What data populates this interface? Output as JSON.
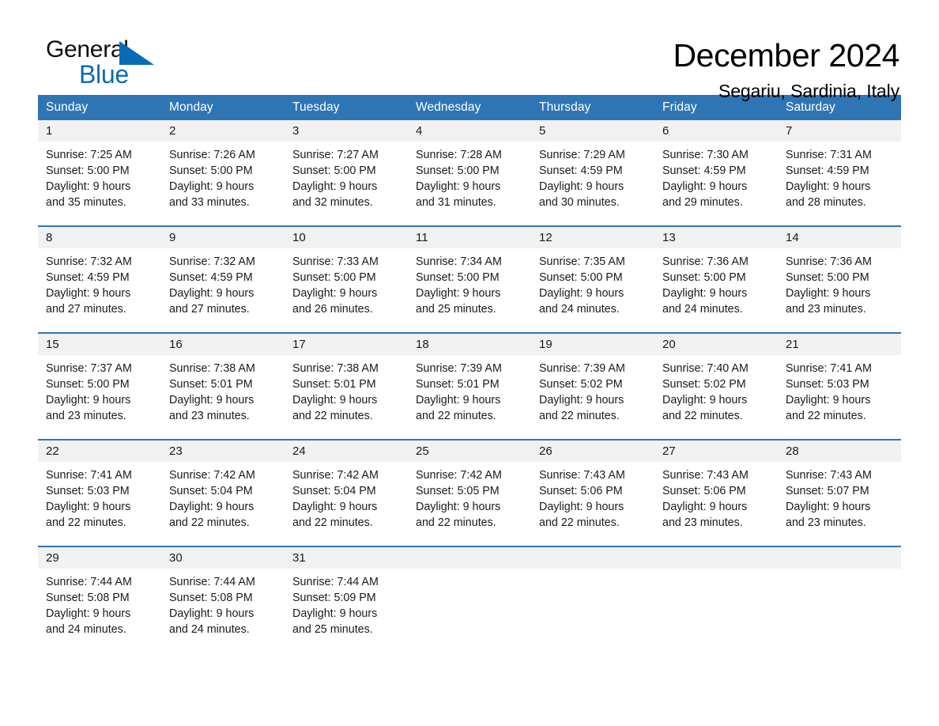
{
  "brand": {
    "name_part1": "General",
    "name_part2": "Blue",
    "triangle_color": "#0a6bb5",
    "accent_color": "#2e75b6"
  },
  "header": {
    "month_title": "December 2024",
    "location": "Segariu, Sardinia, Italy"
  },
  "calendar": {
    "weekday_headers": [
      "Sunday",
      "Monday",
      "Tuesday",
      "Wednesday",
      "Thursday",
      "Friday",
      "Saturday"
    ],
    "weeks": [
      [
        {
          "day": "1",
          "sunrise": "Sunrise: 7:25 AM",
          "sunset": "Sunset: 5:00 PM",
          "daylight_line1": "Daylight: 9 hours",
          "daylight_line2": "and 35 minutes."
        },
        {
          "day": "2",
          "sunrise": "Sunrise: 7:26 AM",
          "sunset": "Sunset: 5:00 PM",
          "daylight_line1": "Daylight: 9 hours",
          "daylight_line2": "and 33 minutes."
        },
        {
          "day": "3",
          "sunrise": "Sunrise: 7:27 AM",
          "sunset": "Sunset: 5:00 PM",
          "daylight_line1": "Daylight: 9 hours",
          "daylight_line2": "and 32 minutes."
        },
        {
          "day": "4",
          "sunrise": "Sunrise: 7:28 AM",
          "sunset": "Sunset: 5:00 PM",
          "daylight_line1": "Daylight: 9 hours",
          "daylight_line2": "and 31 minutes."
        },
        {
          "day": "5",
          "sunrise": "Sunrise: 7:29 AM",
          "sunset": "Sunset: 4:59 PM",
          "daylight_line1": "Daylight: 9 hours",
          "daylight_line2": "and 30 minutes."
        },
        {
          "day": "6",
          "sunrise": "Sunrise: 7:30 AM",
          "sunset": "Sunset: 4:59 PM",
          "daylight_line1": "Daylight: 9 hours",
          "daylight_line2": "and 29 minutes."
        },
        {
          "day": "7",
          "sunrise": "Sunrise: 7:31 AM",
          "sunset": "Sunset: 4:59 PM",
          "daylight_line1": "Daylight: 9 hours",
          "daylight_line2": "and 28 minutes."
        }
      ],
      [
        {
          "day": "8",
          "sunrise": "Sunrise: 7:32 AM",
          "sunset": "Sunset: 4:59 PM",
          "daylight_line1": "Daylight: 9 hours",
          "daylight_line2": "and 27 minutes."
        },
        {
          "day": "9",
          "sunrise": "Sunrise: 7:32 AM",
          "sunset": "Sunset: 4:59 PM",
          "daylight_line1": "Daylight: 9 hours",
          "daylight_line2": "and 27 minutes."
        },
        {
          "day": "10",
          "sunrise": "Sunrise: 7:33 AM",
          "sunset": "Sunset: 5:00 PM",
          "daylight_line1": "Daylight: 9 hours",
          "daylight_line2": "and 26 minutes."
        },
        {
          "day": "11",
          "sunrise": "Sunrise: 7:34 AM",
          "sunset": "Sunset: 5:00 PM",
          "daylight_line1": "Daylight: 9 hours",
          "daylight_line2": "and 25 minutes."
        },
        {
          "day": "12",
          "sunrise": "Sunrise: 7:35 AM",
          "sunset": "Sunset: 5:00 PM",
          "daylight_line1": "Daylight: 9 hours",
          "daylight_line2": "and 24 minutes."
        },
        {
          "day": "13",
          "sunrise": "Sunrise: 7:36 AM",
          "sunset": "Sunset: 5:00 PM",
          "daylight_line1": "Daylight: 9 hours",
          "daylight_line2": "and 24 minutes."
        },
        {
          "day": "14",
          "sunrise": "Sunrise: 7:36 AM",
          "sunset": "Sunset: 5:00 PM",
          "daylight_line1": "Daylight: 9 hours",
          "daylight_line2": "and 23 minutes."
        }
      ],
      [
        {
          "day": "15",
          "sunrise": "Sunrise: 7:37 AM",
          "sunset": "Sunset: 5:00 PM",
          "daylight_line1": "Daylight: 9 hours",
          "daylight_line2": "and 23 minutes."
        },
        {
          "day": "16",
          "sunrise": "Sunrise: 7:38 AM",
          "sunset": "Sunset: 5:01 PM",
          "daylight_line1": "Daylight: 9 hours",
          "daylight_line2": "and 23 minutes."
        },
        {
          "day": "17",
          "sunrise": "Sunrise: 7:38 AM",
          "sunset": "Sunset: 5:01 PM",
          "daylight_line1": "Daylight: 9 hours",
          "daylight_line2": "and 22 minutes."
        },
        {
          "day": "18",
          "sunrise": "Sunrise: 7:39 AM",
          "sunset": "Sunset: 5:01 PM",
          "daylight_line1": "Daylight: 9 hours",
          "daylight_line2": "and 22 minutes."
        },
        {
          "day": "19",
          "sunrise": "Sunrise: 7:39 AM",
          "sunset": "Sunset: 5:02 PM",
          "daylight_line1": "Daylight: 9 hours",
          "daylight_line2": "and 22 minutes."
        },
        {
          "day": "20",
          "sunrise": "Sunrise: 7:40 AM",
          "sunset": "Sunset: 5:02 PM",
          "daylight_line1": "Daylight: 9 hours",
          "daylight_line2": "and 22 minutes."
        },
        {
          "day": "21",
          "sunrise": "Sunrise: 7:41 AM",
          "sunset": "Sunset: 5:03 PM",
          "daylight_line1": "Daylight: 9 hours",
          "daylight_line2": "and 22 minutes."
        }
      ],
      [
        {
          "day": "22",
          "sunrise": "Sunrise: 7:41 AM",
          "sunset": "Sunset: 5:03 PM",
          "daylight_line1": "Daylight: 9 hours",
          "daylight_line2": "and 22 minutes."
        },
        {
          "day": "23",
          "sunrise": "Sunrise: 7:42 AM",
          "sunset": "Sunset: 5:04 PM",
          "daylight_line1": "Daylight: 9 hours",
          "daylight_line2": "and 22 minutes."
        },
        {
          "day": "24",
          "sunrise": "Sunrise: 7:42 AM",
          "sunset": "Sunset: 5:04 PM",
          "daylight_line1": "Daylight: 9 hours",
          "daylight_line2": "and 22 minutes."
        },
        {
          "day": "25",
          "sunrise": "Sunrise: 7:42 AM",
          "sunset": "Sunset: 5:05 PM",
          "daylight_line1": "Daylight: 9 hours",
          "daylight_line2": "and 22 minutes."
        },
        {
          "day": "26",
          "sunrise": "Sunrise: 7:43 AM",
          "sunset": "Sunset: 5:06 PM",
          "daylight_line1": "Daylight: 9 hours",
          "daylight_line2": "and 22 minutes."
        },
        {
          "day": "27",
          "sunrise": "Sunrise: 7:43 AM",
          "sunset": "Sunset: 5:06 PM",
          "daylight_line1": "Daylight: 9 hours",
          "daylight_line2": "and 23 minutes."
        },
        {
          "day": "28",
          "sunrise": "Sunrise: 7:43 AM",
          "sunset": "Sunset: 5:07 PM",
          "daylight_line1": "Daylight: 9 hours",
          "daylight_line2": "and 23 minutes."
        }
      ],
      [
        {
          "day": "29",
          "sunrise": "Sunrise: 7:44 AM",
          "sunset": "Sunset: 5:08 PM",
          "daylight_line1": "Daylight: 9 hours",
          "daylight_line2": "and 24 minutes."
        },
        {
          "day": "30",
          "sunrise": "Sunrise: 7:44 AM",
          "sunset": "Sunset: 5:08 PM",
          "daylight_line1": "Daylight: 9 hours",
          "daylight_line2": "and 24 minutes."
        },
        {
          "day": "31",
          "sunrise": "Sunrise: 7:44 AM",
          "sunset": "Sunset: 5:09 PM",
          "daylight_line1": "Daylight: 9 hours",
          "daylight_line2": "and 25 minutes."
        },
        {
          "day": "",
          "sunrise": "",
          "sunset": "",
          "daylight_line1": "",
          "daylight_line2": ""
        },
        {
          "day": "",
          "sunrise": "",
          "sunset": "",
          "daylight_line1": "",
          "daylight_line2": ""
        },
        {
          "day": "",
          "sunrise": "",
          "sunset": "",
          "daylight_line1": "",
          "daylight_line2": ""
        },
        {
          "day": "",
          "sunrise": "",
          "sunset": "",
          "daylight_line1": "",
          "daylight_line2": ""
        }
      ]
    ]
  }
}
